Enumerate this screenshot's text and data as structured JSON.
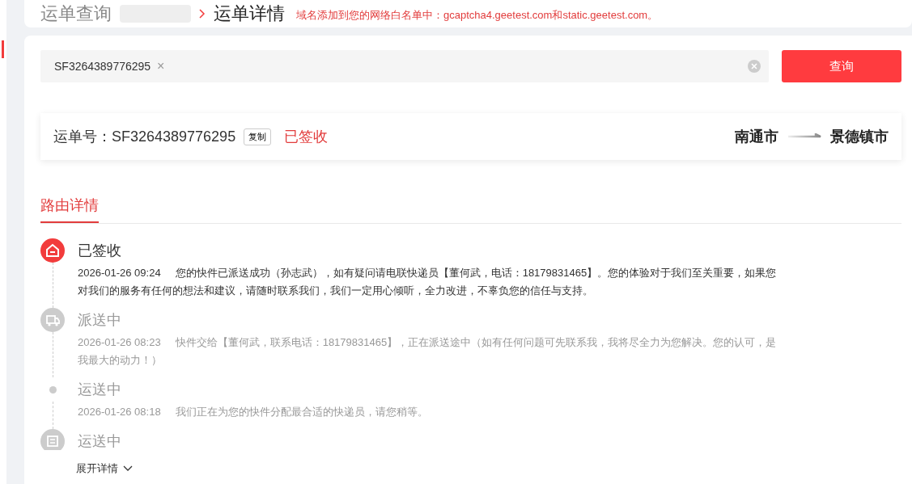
{
  "breadcrumb": {
    "parent": "运单查询",
    "current": "运单详情"
  },
  "notice": "域名添加到您的网络白名单中：gcaptcha4.geetest.com和static.geetest.com。",
  "search": {
    "tag": "SF3264389776295",
    "tag_close": "×",
    "button": "查询"
  },
  "waybill": {
    "label": "运单号：SF3264389776295",
    "copy": "复制",
    "status": "已签收",
    "from": "南通市",
    "to": "景德镇市"
  },
  "tabs": [
    {
      "label": "路由详情",
      "selected": true
    }
  ],
  "route": [
    {
      "kind": "signed",
      "current": true,
      "status": "已签收",
      "time": "2026-01-26 09:24",
      "text": "您的快件已派送成功（孙志武），如有疑问请电联快递员【董何武，电话：18179831465】。您的体验对于我们至关重要，如果您对我们的服务有任何的想法和建议，请随时联系我们，我们一定用心倾听，全力改进，不辜负您的信任与支持。"
    },
    {
      "kind": "delivering",
      "current": false,
      "status": "派送中",
      "time": "2026-01-26 08:23",
      "text": "快件交给【董何武，联系电话：18179831465】，正在派送途中（如有任何问题可先联系我，我将尽全力为您解决。您的认可，是我最大的动力！）"
    },
    {
      "kind": "dot",
      "current": false,
      "status": "运送中",
      "time": "2026-01-26 08:18",
      "text": "我们正在为您的快件分配最合适的快递员，请您稍等。"
    },
    {
      "kind": "transit",
      "current": false,
      "status": "运送中"
    }
  ],
  "expand": "展开详情"
}
